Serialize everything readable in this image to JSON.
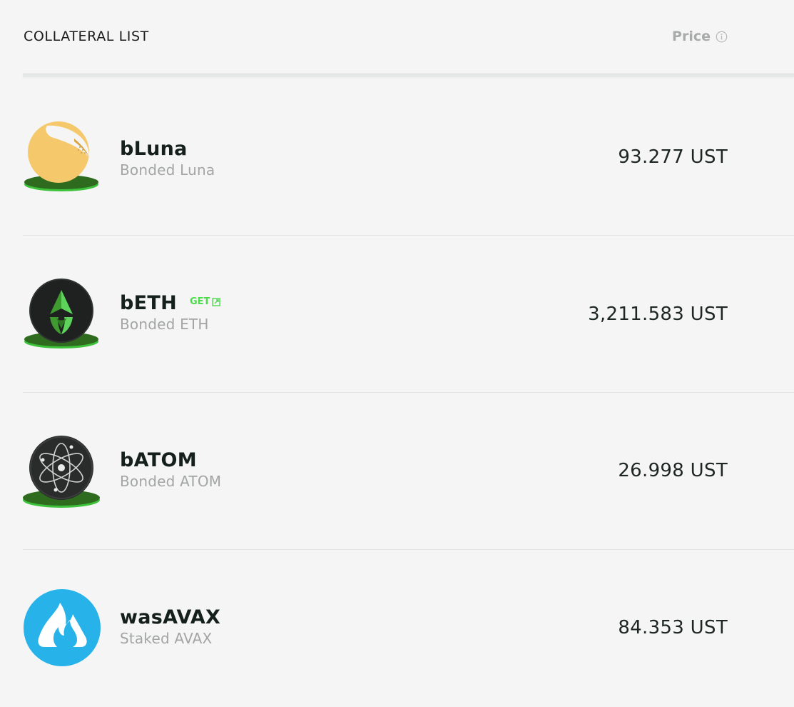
{
  "header": {
    "title": "COLLATERAL LIST",
    "price_label": "Price",
    "price_info_icon": "info-icon"
  },
  "colors": {
    "accent_green": "#4bdb4b",
    "luna_yellow": "#f5c35e",
    "avax_blue": "#27b3ea",
    "icon_dark": "#2a2c2b"
  },
  "collaterals": [
    {
      "symbol": "bLuna",
      "name": "Bonded Luna",
      "price": "93.277 UST",
      "icon": "bluna-icon"
    },
    {
      "symbol": "bETH",
      "name": "Bonded ETH",
      "price": "3,211.583 UST",
      "icon": "beth-icon",
      "get_label": "GET",
      "get_icon": "external-link-icon"
    },
    {
      "symbol": "bATOM",
      "name": "Bonded ATOM",
      "price": "26.998 UST",
      "icon": "batom-icon"
    },
    {
      "symbol": "wasAVAX",
      "name": "Staked AVAX",
      "price": "84.353 UST",
      "icon": "wasavax-icon"
    }
  ]
}
